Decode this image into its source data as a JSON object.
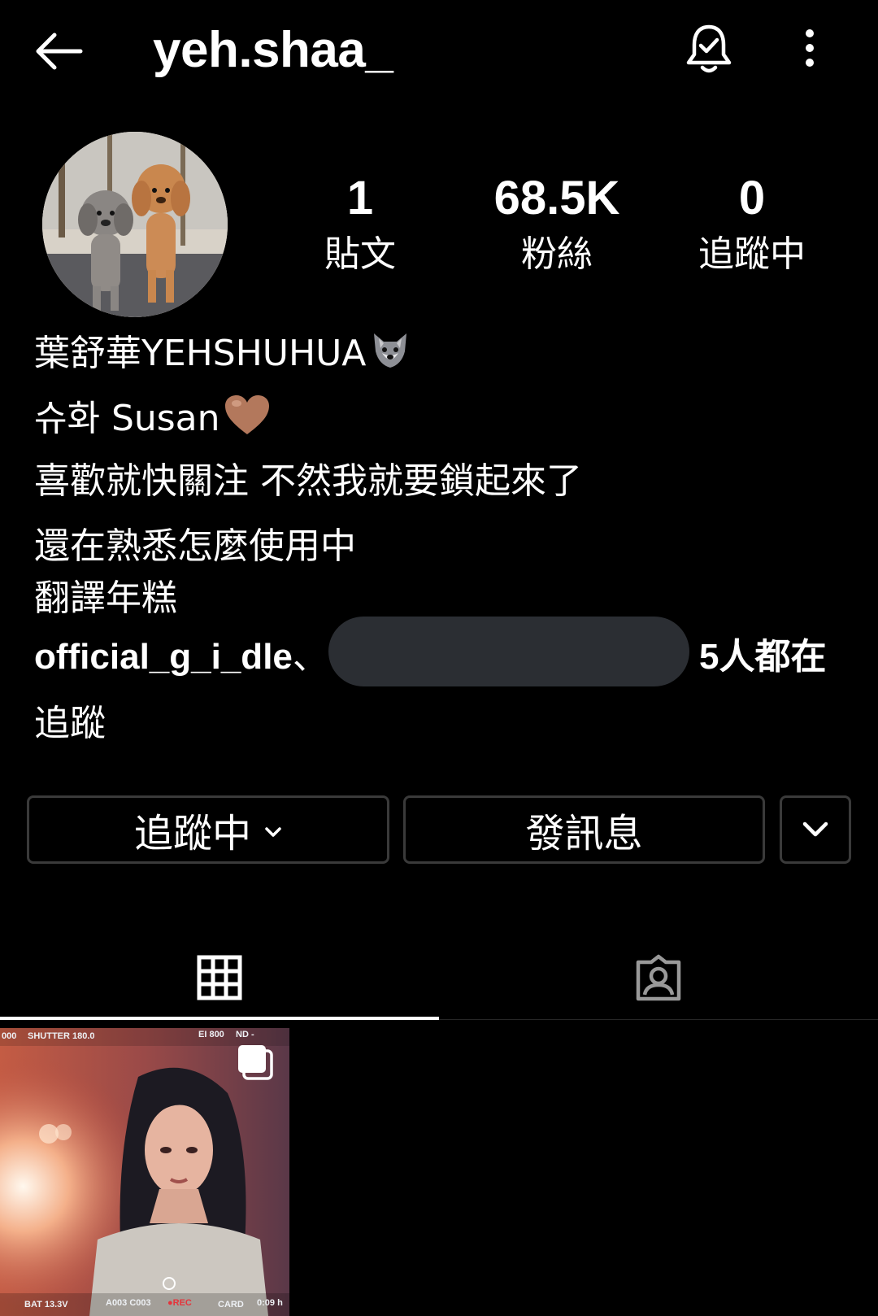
{
  "header": {
    "username": "yeh.shaa_",
    "back_icon": "arrow-left-icon",
    "bell_icon": "bell-check-icon",
    "more_icon": "vertical-dots-icon"
  },
  "profile": {
    "avatar_icon": "avatar-two-poodles",
    "stats": [
      {
        "value": "1",
        "label": "貼文"
      },
      {
        "value": "68.5K",
        "label": "粉絲"
      },
      {
        "value": "0",
        "label": "追蹤中"
      }
    ],
    "name": "葉舒華YEHSHUHUA",
    "bio": [
      "슈화 Susan",
      "喜歡就快關注 不然我就要鎖起來了",
      "還在熟悉怎麼使用中",
      "翻譯年糕"
    ],
    "followed_by": {
      "user": "official_g_i_dle",
      "separator": "、",
      "count_text": "5人都在",
      "line2": "追蹤"
    }
  },
  "actions": {
    "following_label": "追蹤中",
    "message_label": "發訊息"
  },
  "tabs": {
    "grid_icon": "grid-icon",
    "tagged_icon": "tagged-person-icon",
    "active": "grid"
  },
  "post": {
    "hud_top_left": "000",
    "hud_shutter": "SHUTTER 180.0",
    "hud_ei": "EI 800",
    "hud_nd": "ND -",
    "hud_bat": "BAT 13.3V",
    "hud_clip": "A003 C003",
    "hud_rec": "●REC",
    "hud_card": "CARD",
    "hud_time": "0:09 h"
  },
  "colors": {
    "background": "#000000",
    "text": "#ffffff",
    "button_border": "#3a3a3a",
    "redaction": "#2b2e33",
    "rec": "#e5343c"
  }
}
